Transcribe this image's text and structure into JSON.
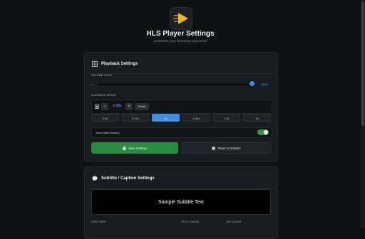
{
  "header": {
    "title": "HLS Player Settings",
    "subtitle": "Customize your streaming experience"
  },
  "playback": {
    "title": "Playback Settings",
    "volume_label": "VOLUME LEVEL",
    "volume_icon": "speaker-icon",
    "volume_value": "100%",
    "volume_fraction": 1.0,
    "speed_label": "PLAYBACK SPEED",
    "speed_minus": "−",
    "speed_value": "1.00x",
    "speed_plus": "+",
    "reset_label": "Reset",
    "presets": [
      "0.5x",
      "0.75x",
      "1x",
      "1.25x",
      "1.5x",
      "2x"
    ],
    "active_preset": "1x",
    "history_label": "Save watch history",
    "history_enabled": true,
    "save_label": "Save Settings",
    "defaults_label": "Reset to Defaults"
  },
  "subtitle": {
    "title": "Subtitle / Caption Settings",
    "sample_text": "Sample Subtitle Text",
    "font_size_label": "FONT SIZE",
    "text_color_label": "TEXT COLOR",
    "bg_color_label": "BG COLOR"
  },
  "colors": {
    "accent": "#3d8fe6",
    "success": "#2a8a3e",
    "logo": "#f2b51d"
  }
}
